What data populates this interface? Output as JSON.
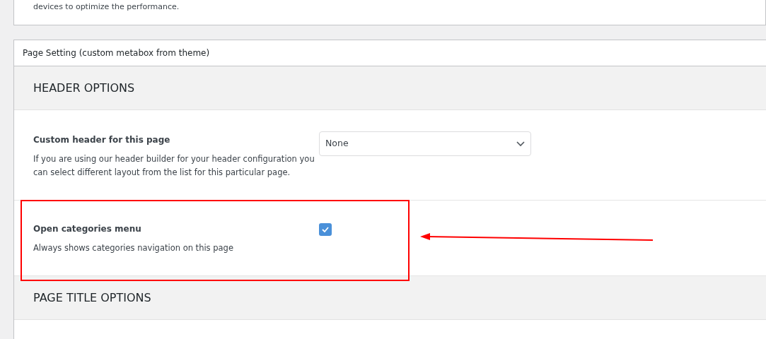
{
  "top_card": {
    "text": "devices to optimize the performance."
  },
  "metabox": {
    "title": "Page Setting (custom metabox from theme)",
    "sections": [
      {
        "kind": "heading",
        "title": "HEADER OPTIONS"
      },
      {
        "kind": "select",
        "label": "Custom header for this page",
        "description": "If you are using our header builder for your header configuration you can select different layout from the list for this particular page.",
        "value": "None"
      },
      {
        "kind": "checkbox",
        "label": "Open categories menu",
        "description": "Always shows categories navigation on this page",
        "checked": true
      },
      {
        "kind": "heading",
        "title": "PAGE TITLE OPTIONS"
      }
    ]
  }
}
